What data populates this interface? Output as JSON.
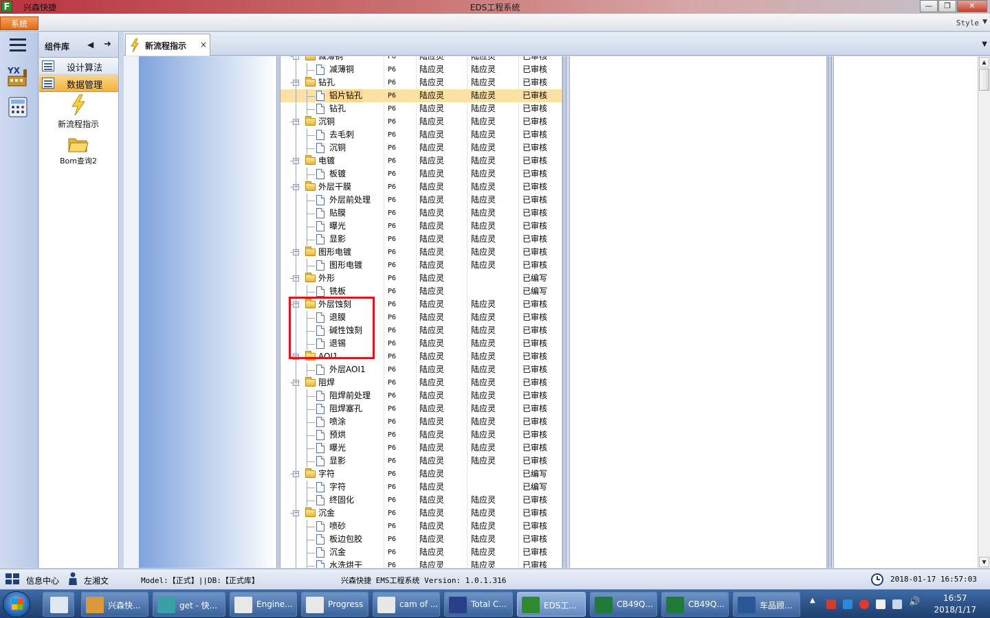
{
  "window": {
    "app_name": "兴森快捷",
    "title": "EDS工程系统",
    "min_glyph": "—",
    "max_glyph": "❐",
    "close_glyph": "✕"
  },
  "menu": {
    "system_label": "系统",
    "style_label": "Style"
  },
  "component_panel": {
    "title": "组件库",
    "nav_items": [
      {
        "label": "设计算法",
        "selected": false
      },
      {
        "label": "数据管理",
        "selected": true
      }
    ],
    "tiles": [
      {
        "label": "新流程指示",
        "icon": "lightning-icon"
      },
      {
        "label": "Bom查询2",
        "icon": "folder-open-icon"
      }
    ]
  },
  "tab": {
    "label": "新流程指示",
    "close": "×"
  },
  "tree": {
    "rows": [
      {
        "level": 0,
        "name": "减薄铜",
        "code": "P6",
        "p1": "陆应灵",
        "p2": "陆应灵",
        "status": "已审核"
      },
      {
        "level": 1,
        "name": "减薄铜",
        "code": "P6",
        "p1": "陆应灵",
        "p2": "陆应灵",
        "status": "已审核"
      },
      {
        "level": 0,
        "name": "钻孔",
        "code": "P6",
        "p1": "陆应灵",
        "p2": "陆应灵",
        "status": "已审核"
      },
      {
        "level": 1,
        "name": "铝片钻孔",
        "code": "P6",
        "p1": "陆应灵",
        "p2": "陆应灵",
        "status": "已审核",
        "selected": true
      },
      {
        "level": 1,
        "name": "钻孔",
        "code": "P6",
        "p1": "陆应灵",
        "p2": "陆应灵",
        "status": "已审核"
      },
      {
        "level": 0,
        "name": "沉铜",
        "code": "P6",
        "p1": "陆应灵",
        "p2": "陆应灵",
        "status": "已审核"
      },
      {
        "level": 1,
        "name": "去毛刺",
        "code": "P6",
        "p1": "陆应灵",
        "p2": "陆应灵",
        "status": "已审核"
      },
      {
        "level": 1,
        "name": "沉铜",
        "code": "P6",
        "p1": "陆应灵",
        "p2": "陆应灵",
        "status": "已审核"
      },
      {
        "level": 0,
        "name": "电镀",
        "code": "P6",
        "p1": "陆应灵",
        "p2": "陆应灵",
        "status": "已审核"
      },
      {
        "level": 1,
        "name": "板镀",
        "code": "P6",
        "p1": "陆应灵",
        "p2": "陆应灵",
        "status": "已审核"
      },
      {
        "level": 0,
        "name": "外层干膜",
        "code": "P6",
        "p1": "陆应灵",
        "p2": "陆应灵",
        "status": "已审核"
      },
      {
        "level": 1,
        "name": "外层前处理",
        "code": "P6",
        "p1": "陆应灵",
        "p2": "陆应灵",
        "status": "已审核"
      },
      {
        "level": 1,
        "name": "贴膜",
        "code": "P6",
        "p1": "陆应灵",
        "p2": "陆应灵",
        "status": "已审核"
      },
      {
        "level": 1,
        "name": "曝光",
        "code": "P6",
        "p1": "陆应灵",
        "p2": "陆应灵",
        "status": "已审核"
      },
      {
        "level": 1,
        "name": "显影",
        "code": "P6",
        "p1": "陆应灵",
        "p2": "陆应灵",
        "status": "已审核"
      },
      {
        "level": 0,
        "name": "图形电镀",
        "code": "P6",
        "p1": "陆应灵",
        "p2": "陆应灵",
        "status": "已审核"
      },
      {
        "level": 1,
        "name": "图形电镀",
        "code": "P6",
        "p1": "陆应灵",
        "p2": "陆应灵",
        "status": "已审核"
      },
      {
        "level": 0,
        "name": "外形",
        "code": "P6",
        "p1": "陆应灵",
        "p2": "",
        "status": "已编写"
      },
      {
        "level": 1,
        "name": "铣板",
        "code": "P6",
        "p1": "陆应灵",
        "p2": "",
        "status": "已编写"
      },
      {
        "level": 0,
        "name": "外层蚀刻",
        "code": "P6",
        "p1": "陆应灵",
        "p2": "陆应灵",
        "status": "已审核"
      },
      {
        "level": 1,
        "name": "退膜",
        "code": "P6",
        "p1": "陆应灵",
        "p2": "陆应灵",
        "status": "已审核"
      },
      {
        "level": 1,
        "name": "碱性蚀刻",
        "code": "P6",
        "p1": "陆应灵",
        "p2": "陆应灵",
        "status": "已审核"
      },
      {
        "level": 1,
        "name": "退锡",
        "code": "P6",
        "p1": "陆应灵",
        "p2": "陆应灵",
        "status": "已审核"
      },
      {
        "level": 0,
        "name": "AOI1",
        "code": "P6",
        "p1": "陆应灵",
        "p2": "陆应灵",
        "status": "已审核"
      },
      {
        "level": 1,
        "name": "外层AOI1",
        "code": "P6",
        "p1": "陆应灵",
        "p2": "陆应灵",
        "status": "已审核"
      },
      {
        "level": 0,
        "name": "阻焊",
        "code": "P6",
        "p1": "陆应灵",
        "p2": "陆应灵",
        "status": "已审核"
      },
      {
        "level": 1,
        "name": "阻焊前处理",
        "code": "P6",
        "p1": "陆应灵",
        "p2": "陆应灵",
        "status": "已审核"
      },
      {
        "level": 1,
        "name": "阻焊塞孔",
        "code": "P6",
        "p1": "陆应灵",
        "p2": "陆应灵",
        "status": "已审核"
      },
      {
        "level": 1,
        "name": "喷涂",
        "code": "P6",
        "p1": "陆应灵",
        "p2": "陆应灵",
        "status": "已审核"
      },
      {
        "level": 1,
        "name": "预烘",
        "code": "P6",
        "p1": "陆应灵",
        "p2": "陆应灵",
        "status": "已审核"
      },
      {
        "level": 1,
        "name": "曝光",
        "code": "P6",
        "p1": "陆应灵",
        "p2": "陆应灵",
        "status": "已审核"
      },
      {
        "level": 1,
        "name": "显影",
        "code": "P6",
        "p1": "陆应灵",
        "p2": "陆应灵",
        "status": "已审核"
      },
      {
        "level": 0,
        "name": "字符",
        "code": "P6",
        "p1": "陆应灵",
        "p2": "",
        "status": "已编写"
      },
      {
        "level": 1,
        "name": "字符",
        "code": "P6",
        "p1": "陆应灵",
        "p2": "",
        "status": "已编写"
      },
      {
        "level": 1,
        "name": "终固化",
        "code": "P6",
        "p1": "陆应灵",
        "p2": "陆应灵",
        "status": "已审核"
      },
      {
        "level": 0,
        "name": "沉金",
        "code": "P6",
        "p1": "陆应灵",
        "p2": "陆应灵",
        "status": "已审核"
      },
      {
        "level": 1,
        "name": "喷砂",
        "code": "P6",
        "p1": "陆应灵",
        "p2": "陆应灵",
        "status": "已审核"
      },
      {
        "level": 1,
        "name": "板边包胶",
        "code": "P6",
        "p1": "陆应灵",
        "p2": "陆应灵",
        "status": "已审核"
      },
      {
        "level": 1,
        "name": "沉金",
        "code": "P6",
        "p1": "陆应灵",
        "p2": "陆应灵",
        "status": "已审核"
      },
      {
        "level": 1,
        "name": "水洗烘干",
        "code": "P6",
        "p1": "陆应灵",
        "p2": "陆应灵",
        "status": "已审核"
      }
    ]
  },
  "status": {
    "info_center": "信息中心",
    "user": "左湘文",
    "model": "Model:【正式】||DB:【正式库】",
    "system": "兴森快捷 EMS工程系统 Version: 1.0.1.316",
    "datetime": "2018-01-17 16:57:03"
  },
  "taskbar": {
    "items": [
      {
        "label": "兴森快...",
        "active": false,
        "color": "#d89a3a"
      },
      {
        "label": "get - 快...",
        "active": false,
        "color": "#3aa0a8"
      },
      {
        "label": "Engine...",
        "active": false,
        "color": "#e8e8e8"
      },
      {
        "label": "Progress",
        "active": false,
        "color": "#e8e8e8"
      },
      {
        "label": "cam of ...",
        "active": false,
        "color": "#e8e8e8"
      },
      {
        "label": "Total C...",
        "active": false,
        "color": "#2a3f8a"
      },
      {
        "label": "EDS工...",
        "active": true,
        "color": "#2f8a2f"
      },
      {
        "label": "CB49Q...",
        "active": false,
        "color": "#1f7a3a"
      },
      {
        "label": "CB49Q...",
        "active": false,
        "color": "#1f7a3a"
      },
      {
        "label": "车品顾...",
        "active": false,
        "color": "#2b5797"
      }
    ],
    "clock_time": "16:57",
    "clock_date": "2018/1/17"
  },
  "colors": {
    "highlight": "#e0141b",
    "selection": "#fbd58a"
  }
}
